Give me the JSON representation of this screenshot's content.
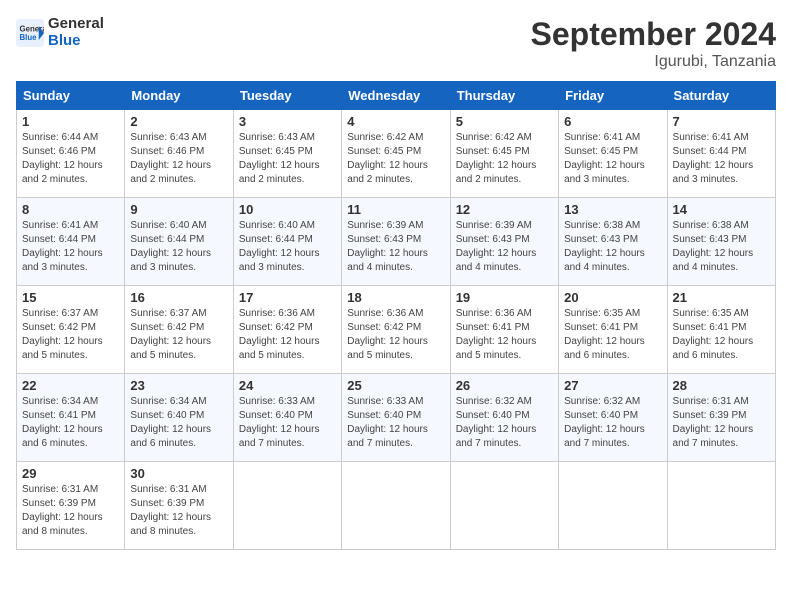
{
  "header": {
    "logo_line1": "General",
    "logo_line2": "Blue",
    "month": "September 2024",
    "location": "Igurubi, Tanzania"
  },
  "weekdays": [
    "Sunday",
    "Monday",
    "Tuesday",
    "Wednesday",
    "Thursday",
    "Friday",
    "Saturday"
  ],
  "weeks": [
    [
      {
        "day": "1",
        "sunrise": "6:44 AM",
        "sunset": "6:46 PM",
        "daylight": "12 hours and 2 minutes."
      },
      {
        "day": "2",
        "sunrise": "6:43 AM",
        "sunset": "6:46 PM",
        "daylight": "12 hours and 2 minutes."
      },
      {
        "day": "3",
        "sunrise": "6:43 AM",
        "sunset": "6:45 PM",
        "daylight": "12 hours and 2 minutes."
      },
      {
        "day": "4",
        "sunrise": "6:42 AM",
        "sunset": "6:45 PM",
        "daylight": "12 hours and 2 minutes."
      },
      {
        "day": "5",
        "sunrise": "6:42 AM",
        "sunset": "6:45 PM",
        "daylight": "12 hours and 2 minutes."
      },
      {
        "day": "6",
        "sunrise": "6:41 AM",
        "sunset": "6:45 PM",
        "daylight": "12 hours and 3 minutes."
      },
      {
        "day": "7",
        "sunrise": "6:41 AM",
        "sunset": "6:44 PM",
        "daylight": "12 hours and 3 minutes."
      }
    ],
    [
      {
        "day": "8",
        "sunrise": "6:41 AM",
        "sunset": "6:44 PM",
        "daylight": "12 hours and 3 minutes."
      },
      {
        "day": "9",
        "sunrise": "6:40 AM",
        "sunset": "6:44 PM",
        "daylight": "12 hours and 3 minutes."
      },
      {
        "day": "10",
        "sunrise": "6:40 AM",
        "sunset": "6:44 PM",
        "daylight": "12 hours and 3 minutes."
      },
      {
        "day": "11",
        "sunrise": "6:39 AM",
        "sunset": "6:43 PM",
        "daylight": "12 hours and 4 minutes."
      },
      {
        "day": "12",
        "sunrise": "6:39 AM",
        "sunset": "6:43 PM",
        "daylight": "12 hours and 4 minutes."
      },
      {
        "day": "13",
        "sunrise": "6:38 AM",
        "sunset": "6:43 PM",
        "daylight": "12 hours and 4 minutes."
      },
      {
        "day": "14",
        "sunrise": "6:38 AM",
        "sunset": "6:43 PM",
        "daylight": "12 hours and 4 minutes."
      }
    ],
    [
      {
        "day": "15",
        "sunrise": "6:37 AM",
        "sunset": "6:42 PM",
        "daylight": "12 hours and 5 minutes."
      },
      {
        "day": "16",
        "sunrise": "6:37 AM",
        "sunset": "6:42 PM",
        "daylight": "12 hours and 5 minutes."
      },
      {
        "day": "17",
        "sunrise": "6:36 AM",
        "sunset": "6:42 PM",
        "daylight": "12 hours and 5 minutes."
      },
      {
        "day": "18",
        "sunrise": "6:36 AM",
        "sunset": "6:42 PM",
        "daylight": "12 hours and 5 minutes."
      },
      {
        "day": "19",
        "sunrise": "6:36 AM",
        "sunset": "6:41 PM",
        "daylight": "12 hours and 5 minutes."
      },
      {
        "day": "20",
        "sunrise": "6:35 AM",
        "sunset": "6:41 PM",
        "daylight": "12 hours and 6 minutes."
      },
      {
        "day": "21",
        "sunrise": "6:35 AM",
        "sunset": "6:41 PM",
        "daylight": "12 hours and 6 minutes."
      }
    ],
    [
      {
        "day": "22",
        "sunrise": "6:34 AM",
        "sunset": "6:41 PM",
        "daylight": "12 hours and 6 minutes."
      },
      {
        "day": "23",
        "sunrise": "6:34 AM",
        "sunset": "6:40 PM",
        "daylight": "12 hours and 6 minutes."
      },
      {
        "day": "24",
        "sunrise": "6:33 AM",
        "sunset": "6:40 PM",
        "daylight": "12 hours and 7 minutes."
      },
      {
        "day": "25",
        "sunrise": "6:33 AM",
        "sunset": "6:40 PM",
        "daylight": "12 hours and 7 minutes."
      },
      {
        "day": "26",
        "sunrise": "6:32 AM",
        "sunset": "6:40 PM",
        "daylight": "12 hours and 7 minutes."
      },
      {
        "day": "27",
        "sunrise": "6:32 AM",
        "sunset": "6:40 PM",
        "daylight": "12 hours and 7 minutes."
      },
      {
        "day": "28",
        "sunrise": "6:31 AM",
        "sunset": "6:39 PM",
        "daylight": "12 hours and 7 minutes."
      }
    ],
    [
      {
        "day": "29",
        "sunrise": "6:31 AM",
        "sunset": "6:39 PM",
        "daylight": "12 hours and 8 minutes."
      },
      {
        "day": "30",
        "sunrise": "6:31 AM",
        "sunset": "6:39 PM",
        "daylight": "12 hours and 8 minutes."
      },
      null,
      null,
      null,
      null,
      null
    ]
  ]
}
